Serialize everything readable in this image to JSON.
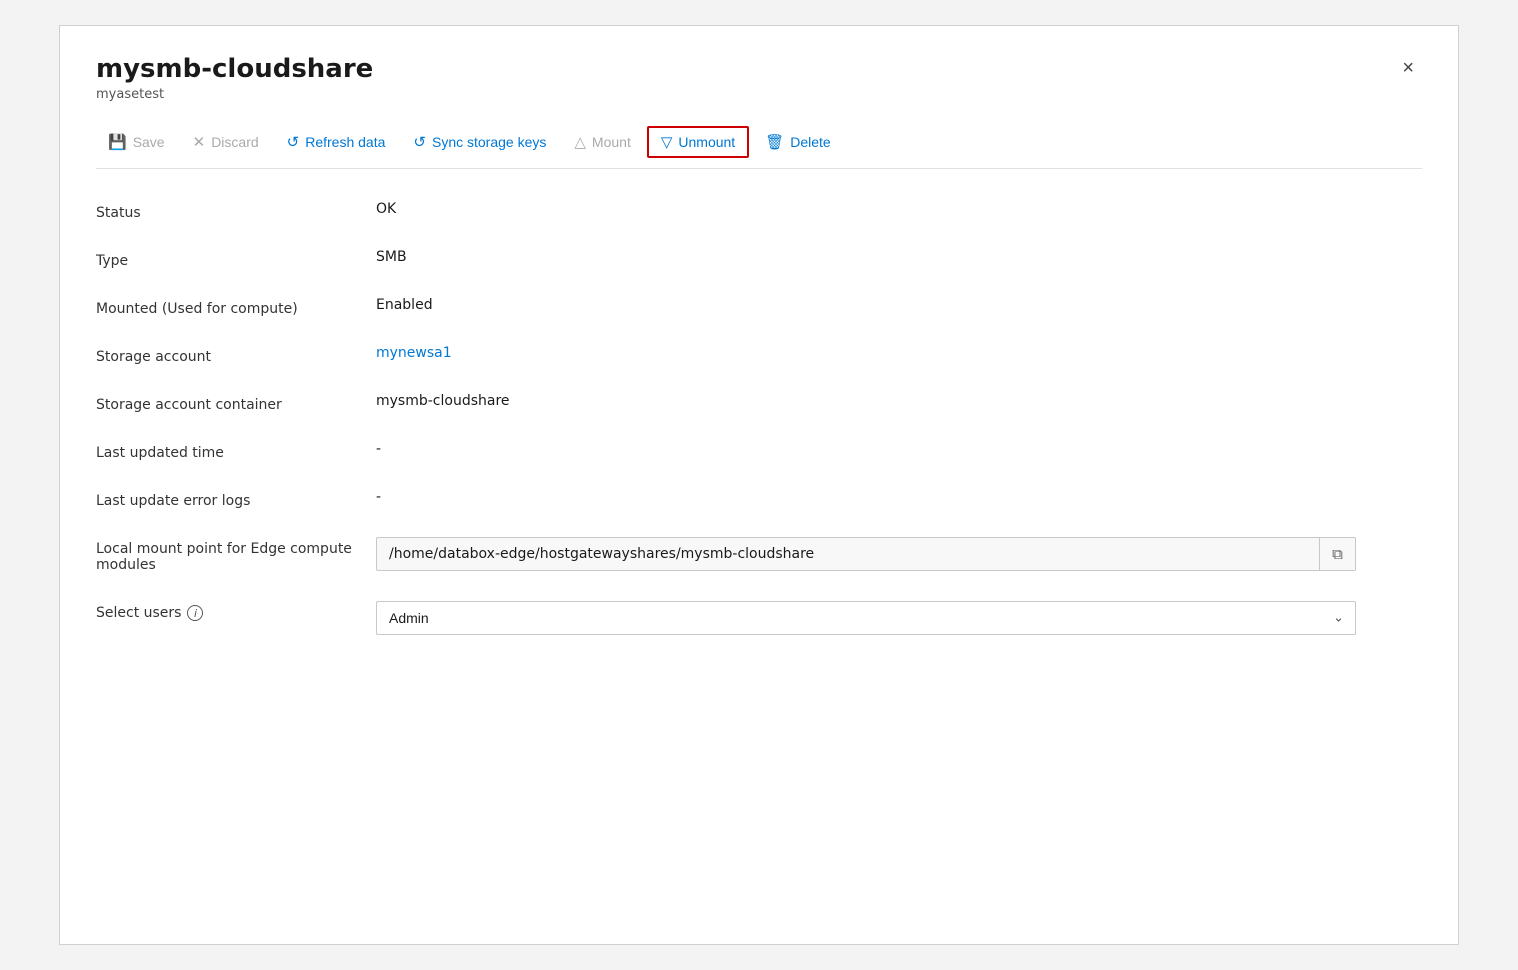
{
  "panel": {
    "title": "mysmb-cloudshare",
    "subtitle": "myasetest"
  },
  "toolbar": {
    "save_label": "Save",
    "discard_label": "Discard",
    "refresh_label": "Refresh data",
    "sync_label": "Sync storage keys",
    "mount_label": "Mount",
    "unmount_label": "Unmount",
    "delete_label": "Delete"
  },
  "fields": [
    {
      "label": "Status",
      "value": "OK"
    },
    {
      "label": "Type",
      "value": "SMB"
    },
    {
      "label": "Mounted (Used for compute)",
      "value": "Enabled"
    },
    {
      "label": "Storage account",
      "value": "mynewsa1"
    },
    {
      "label": "Storage account container",
      "value": "mysmb-cloudshare"
    },
    {
      "label": "Last updated time",
      "value": "-"
    },
    {
      "label": "Last update error logs",
      "value": "-"
    }
  ],
  "local_mount": {
    "label": "Local mount point for Edge compute modules",
    "value": "/home/databox-edge/hostgatewayshares/mysmb-cloudshare"
  },
  "select_users": {
    "label": "Select users",
    "value": "Admin",
    "options": [
      "Admin"
    ]
  },
  "close_button": "×",
  "copy_icon": "⧉",
  "chevron_down": "∨"
}
